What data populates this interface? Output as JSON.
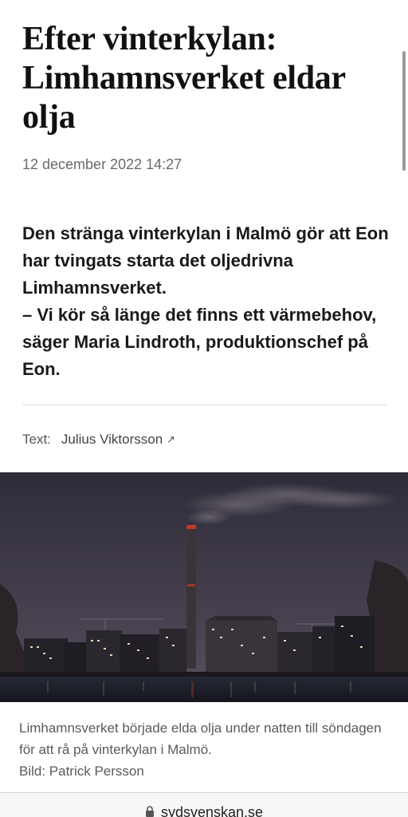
{
  "article": {
    "headline": "Efter vinterkylan: Limhamnsverket eldar olja",
    "date": "12 december 2022 14:27",
    "lead_line1": "Den stränga vinterkylan i Malmö gör att Eon har tvingats starta det oljedrivna Limhamnsverket.",
    "lead_line2": "– Vi kör så länge det finns ett värmebehov, säger Maria Lindroth, produktionschef på Eon.",
    "byline_label": "Text:",
    "byline_author": "Julius Viktorsson",
    "byline_ext_icon": "↗"
  },
  "image": {
    "caption": "Limhamnsverket började elda olja under natten till söndagen för att rå på vinterkylan i Malmö.",
    "credit": "Bild: Patrick Persson"
  },
  "browser": {
    "url": "sydsvenskan.se"
  },
  "colors": {
    "sky": "#3b3644",
    "water": "#1d1f2a",
    "chimney_light": "#c0392b"
  }
}
